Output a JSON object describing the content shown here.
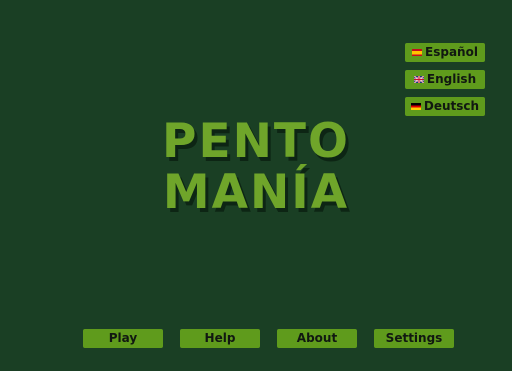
{
  "languages": [
    {
      "label": "Español",
      "flag": "spain-flag-icon"
    },
    {
      "label": "English",
      "flag": "uk-flag-icon"
    },
    {
      "label": "Deutsch",
      "flag": "germany-flag-icon"
    }
  ],
  "title": {
    "line1": "PENTO",
    "line2": "MANÍA"
  },
  "menu": {
    "play": "Play",
    "help": "Help",
    "about": "About",
    "settings": "Settings"
  },
  "colors": {
    "background": "#1a3f24",
    "button": "#5f9b1c",
    "title": "#6fa52a",
    "title_shadow": "#0d2514",
    "button_text": "#111811"
  }
}
